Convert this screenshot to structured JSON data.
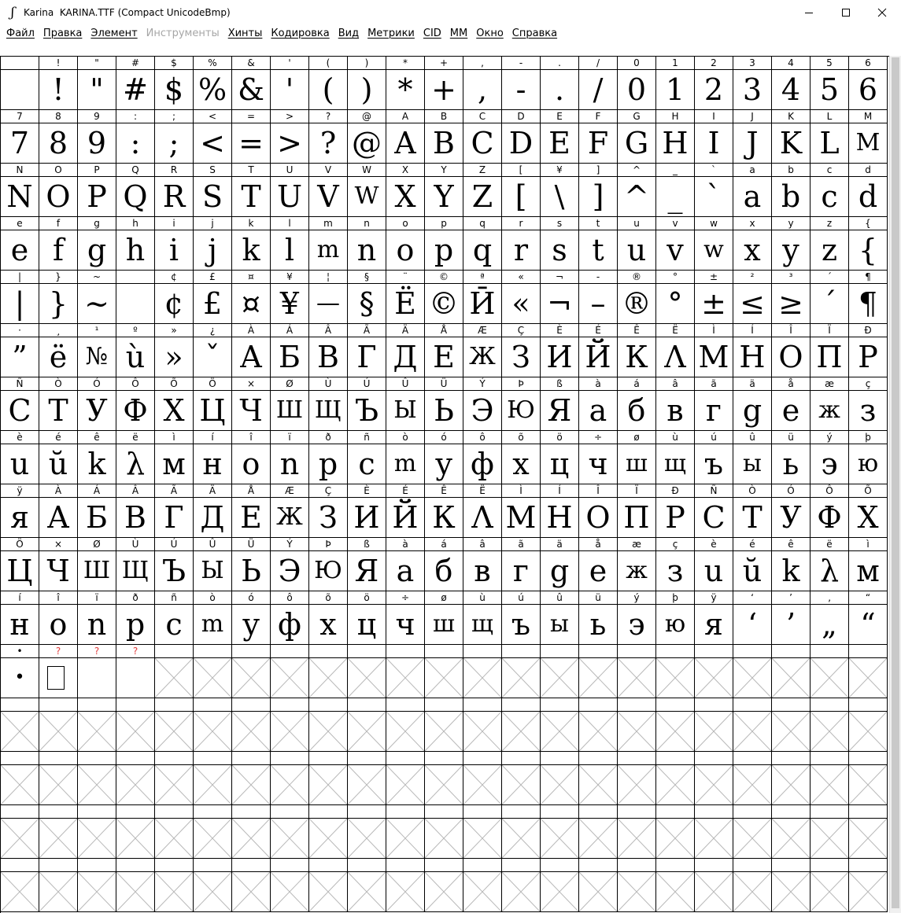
{
  "window": {
    "title": "Karina  KARINA.TTF (Compact UnicodeBmp)",
    "app_icon_glyph": "ʃ"
  },
  "menu": [
    {
      "label": "Файл",
      "enabled": true
    },
    {
      "label": "Правка",
      "enabled": true
    },
    {
      "label": "Элемент",
      "enabled": true
    },
    {
      "label": "Инструменты",
      "enabled": false
    },
    {
      "label": "Хинты",
      "enabled": true
    },
    {
      "label": "Кодировка",
      "enabled": true
    },
    {
      "label": "Вид",
      "enabled": true
    },
    {
      "label": "Метрики",
      "enabled": true
    },
    {
      "label": "CID",
      "enabled": true
    },
    {
      "label": "MM",
      "enabled": true
    },
    {
      "label": "Окно",
      "enabled": true
    },
    {
      "label": "Справка",
      "enabled": true
    }
  ],
  "glyph_rows": [
    [
      [
        " ",
        " "
      ],
      [
        "!",
        "!"
      ],
      [
        "\"",
        "\""
      ],
      [
        "#",
        "#"
      ],
      [
        "$",
        "$"
      ],
      [
        "%",
        "%"
      ],
      [
        "&",
        "&"
      ],
      [
        "'",
        "'"
      ],
      [
        "(",
        "("
      ],
      [
        ")",
        ")"
      ],
      [
        "*",
        "*"
      ],
      [
        "+",
        "+"
      ],
      [
        ",",
        ","
      ],
      [
        "-",
        "-"
      ],
      [
        ".",
        "."
      ],
      [
        "/",
        "/"
      ],
      [
        "0",
        "0"
      ],
      [
        "1",
        "1"
      ],
      [
        "2",
        "2"
      ],
      [
        "3",
        "3"
      ],
      [
        "4",
        "4"
      ],
      [
        "5",
        "5"
      ],
      [
        "6",
        "6"
      ]
    ],
    [
      [
        "7",
        "7"
      ],
      [
        "8",
        "8"
      ],
      [
        "9",
        "9"
      ],
      [
        ":",
        ":"
      ],
      [
        ";",
        ";"
      ],
      [
        "<",
        "<"
      ],
      [
        "=",
        "="
      ],
      [
        ">",
        ">"
      ],
      [
        "?",
        "?"
      ],
      [
        "@",
        "@"
      ],
      [
        "A",
        "A"
      ],
      [
        "B",
        "B"
      ],
      [
        "C",
        "C"
      ],
      [
        "D",
        "D"
      ],
      [
        "E",
        "E"
      ],
      [
        "F",
        "F"
      ],
      [
        "G",
        "G"
      ],
      [
        "H",
        "H"
      ],
      [
        "I",
        "I"
      ],
      [
        "J",
        "J"
      ],
      [
        "K",
        "K"
      ],
      [
        "L",
        "L"
      ],
      [
        "M",
        "M"
      ]
    ],
    [
      [
        "N",
        "N"
      ],
      [
        "O",
        "O"
      ],
      [
        "P",
        "P"
      ],
      [
        "Q",
        "Q"
      ],
      [
        "R",
        "R"
      ],
      [
        "S",
        "S"
      ],
      [
        "T",
        "T"
      ],
      [
        "U",
        "U"
      ],
      [
        "V",
        "V"
      ],
      [
        "W",
        "W"
      ],
      [
        "X",
        "X"
      ],
      [
        "Y",
        "Y"
      ],
      [
        "Z",
        "Z"
      ],
      [
        "[",
        "["
      ],
      [
        "¥",
        "\\"
      ],
      [
        "]",
        "]"
      ],
      [
        "^",
        "^"
      ],
      [
        "_",
        "_"
      ],
      [
        "`",
        "`"
      ],
      [
        "a",
        "a"
      ],
      [
        "b",
        "b"
      ],
      [
        "c",
        "c"
      ],
      [
        "d",
        "d"
      ]
    ],
    [
      [
        "e",
        "e"
      ],
      [
        "f",
        "f"
      ],
      [
        "g",
        "g"
      ],
      [
        "h",
        "h"
      ],
      [
        "i",
        "i"
      ],
      [
        "j",
        "j"
      ],
      [
        "k",
        "k"
      ],
      [
        "l",
        "l"
      ],
      [
        "m",
        "m"
      ],
      [
        "n",
        "n"
      ],
      [
        "o",
        "o"
      ],
      [
        "p",
        "p"
      ],
      [
        "q",
        "q"
      ],
      [
        "r",
        "r"
      ],
      [
        "s",
        "s"
      ],
      [
        "t",
        "t"
      ],
      [
        "u",
        "u"
      ],
      [
        "v",
        "v"
      ],
      [
        "w",
        "w"
      ],
      [
        "x",
        "x"
      ],
      [
        "y",
        "y"
      ],
      [
        "z",
        "z"
      ],
      [
        "{",
        "{"
      ]
    ],
    [
      [
        "|",
        "|"
      ],
      [
        "}",
        "}"
      ],
      [
        "~",
        "~"
      ],
      [
        " ",
        " "
      ],
      [
        "¢",
        "¢"
      ],
      [
        "£",
        "£"
      ],
      [
        "¤",
        "¤"
      ],
      [
        "¥",
        "¥"
      ],
      [
        "¦",
        "—"
      ],
      [
        "§",
        "§"
      ],
      [
        "¨",
        "Ё"
      ],
      [
        "©",
        "©"
      ],
      [
        "ª",
        "Ӣ"
      ],
      [
        "«",
        "«"
      ],
      [
        "¬",
        "¬"
      ],
      [
        "-",
        "–"
      ],
      [
        "®",
        "®"
      ],
      [
        "°",
        "°"
      ],
      [
        "±",
        "±"
      ],
      [
        "²",
        "≤"
      ],
      [
        "³",
        "≥"
      ],
      [
        "´",
        "´"
      ],
      [
        "¶",
        "¶"
      ]
    ],
    [
      [
        "·",
        "”"
      ],
      [
        "¸",
        "ё"
      ],
      [
        "¹",
        "№"
      ],
      [
        "º",
        "ù"
      ],
      [
        "»",
        "»"
      ],
      [
        "¿",
        "ˇ"
      ],
      [
        "À",
        "А"
      ],
      [
        "Á",
        "Б"
      ],
      [
        "Â",
        "В"
      ],
      [
        "Ã",
        "Г"
      ],
      [
        "Ä",
        "Д"
      ],
      [
        "Å",
        "Е"
      ],
      [
        "Æ",
        "Ж"
      ],
      [
        "Ç",
        "З"
      ],
      [
        "È",
        "И"
      ],
      [
        "É",
        "Й"
      ],
      [
        "Ê",
        "К"
      ],
      [
        "Ë",
        "Λ"
      ],
      [
        "Ì",
        "М"
      ],
      [
        "Í",
        "Н"
      ],
      [
        "Î",
        "О"
      ],
      [
        "Ï",
        "П"
      ],
      [
        "Ð",
        "Р"
      ]
    ],
    [
      [
        "Ñ",
        "С"
      ],
      [
        "Ò",
        "Т"
      ],
      [
        "Ó",
        "У"
      ],
      [
        "Ô",
        "Ф"
      ],
      [
        "Õ",
        "Х"
      ],
      [
        "Ö",
        "Ц"
      ],
      [
        "×",
        "Ч"
      ],
      [
        "Ø",
        "Ш"
      ],
      [
        "Ù",
        "Щ"
      ],
      [
        "Ú",
        "Ъ"
      ],
      [
        "Û",
        "Ы"
      ],
      [
        "Ü",
        "Ь"
      ],
      [
        "Ý",
        "Э"
      ],
      [
        "Þ",
        "Ю"
      ],
      [
        "ß",
        "Я"
      ],
      [
        "à",
        "а"
      ],
      [
        "á",
        "б"
      ],
      [
        "â",
        "в"
      ],
      [
        "ã",
        "г"
      ],
      [
        "ä",
        "g"
      ],
      [
        "å",
        "е"
      ],
      [
        "æ",
        "ж"
      ],
      [
        "ç",
        "з"
      ]
    ],
    [
      [
        "è",
        "u"
      ],
      [
        "é",
        "ŭ"
      ],
      [
        "ê",
        "k"
      ],
      [
        "ë",
        "λ"
      ],
      [
        "ì",
        "м"
      ],
      [
        "í",
        "н"
      ],
      [
        "î",
        "о"
      ],
      [
        "ï",
        "n"
      ],
      [
        "ð",
        "p"
      ],
      [
        "ñ",
        "с"
      ],
      [
        "ò",
        "m"
      ],
      [
        "ó",
        "у"
      ],
      [
        "ô",
        "ф"
      ],
      [
        "õ",
        "х"
      ],
      [
        "ö",
        "ц"
      ],
      [
        "÷",
        "ч"
      ],
      [
        "ø",
        "ш"
      ],
      [
        "ù",
        "щ"
      ],
      [
        "ú",
        "ъ"
      ],
      [
        "û",
        "ы"
      ],
      [
        "ü",
        "ь"
      ],
      [
        "ý",
        "э"
      ],
      [
        "þ",
        "ю"
      ]
    ],
    [
      [
        "ÿ",
        "я"
      ],
      [
        "À",
        "А"
      ],
      [
        "Á",
        "Б"
      ],
      [
        "Â",
        "В"
      ],
      [
        "Ã",
        "Г"
      ],
      [
        "Ä",
        "Д"
      ],
      [
        "Å",
        "Е"
      ],
      [
        "Æ",
        "Ж"
      ],
      [
        "Ç",
        "З"
      ],
      [
        "È",
        "И"
      ],
      [
        "É",
        "Й"
      ],
      [
        "Ê",
        "К"
      ],
      [
        "Ë",
        "Λ"
      ],
      [
        "Ì",
        "М"
      ],
      [
        "Í",
        "Н"
      ],
      [
        "Î",
        "О"
      ],
      [
        "Ï",
        "П"
      ],
      [
        "Ð",
        "Р"
      ],
      [
        "Ñ",
        "С"
      ],
      [
        "Ò",
        "Т"
      ],
      [
        "Ó",
        "У"
      ],
      [
        "Ô",
        "Ф"
      ],
      [
        "Õ",
        "Х"
      ]
    ],
    [
      [
        "Ö",
        "Ц"
      ],
      [
        "×",
        "Ч"
      ],
      [
        "Ø",
        "Ш"
      ],
      [
        "Ù",
        "Щ"
      ],
      [
        "Ú",
        "Ъ"
      ],
      [
        "Û",
        "Ы"
      ],
      [
        "Ü",
        "Ь"
      ],
      [
        "Ý",
        "Э"
      ],
      [
        "Þ",
        "Ю"
      ],
      [
        "ß",
        "Я"
      ],
      [
        "à",
        "а"
      ],
      [
        "á",
        "б"
      ],
      [
        "â",
        "в"
      ],
      [
        "ã",
        "г"
      ],
      [
        "ä",
        "g"
      ],
      [
        "å",
        "е"
      ],
      [
        "æ",
        "ж"
      ],
      [
        "ç",
        "з"
      ],
      [
        "è",
        "u"
      ],
      [
        "é",
        "ŭ"
      ],
      [
        "ê",
        "k"
      ],
      [
        "ë",
        "λ"
      ],
      [
        "ì",
        "м"
      ]
    ],
    [
      [
        "í",
        "н"
      ],
      [
        "î",
        "о"
      ],
      [
        "ï",
        "n"
      ],
      [
        "ð",
        "p"
      ],
      [
        "ñ",
        "с"
      ],
      [
        "ò",
        "m"
      ],
      [
        "ó",
        "у"
      ],
      [
        "ô",
        "ф"
      ],
      [
        "õ",
        "х"
      ],
      [
        "ö",
        "ц"
      ],
      [
        "÷",
        "ч"
      ],
      [
        "ø",
        "ш"
      ],
      [
        "ù",
        "щ"
      ],
      [
        "ú",
        "ъ"
      ],
      [
        "û",
        "ы"
      ],
      [
        "ü",
        "ь"
      ],
      [
        "ý",
        "э"
      ],
      [
        "þ",
        "ю"
      ],
      [
        "ÿ",
        "я"
      ],
      [
        "‘",
        "‘"
      ],
      [
        "’",
        "’"
      ],
      [
        "‚",
        "„"
      ],
      [
        "“",
        "“"
      ]
    ],
    [
      [
        "•",
        "•"
      ],
      [
        "?",
        "□"
      ],
      [
        "?",
        ""
      ],
      [
        "?",
        ""
      ]
    ]
  ],
  "missing_label_color": "#e23b3b"
}
